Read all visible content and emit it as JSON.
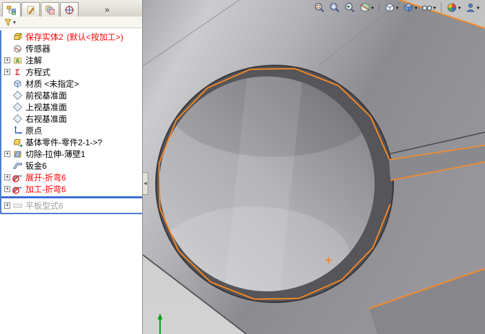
{
  "manager_panel": {
    "tabs": [
      {
        "name": "featuremanager-tree-tab",
        "icon": "design-tree",
        "active": true
      },
      {
        "name": "propertymanager-tab",
        "icon": "property",
        "active": false
      },
      {
        "name": "configurationmanager-tab",
        "icon": "configurations",
        "active": false
      },
      {
        "name": "dimxpert-tab",
        "icon": "dimxpert",
        "active": false
      }
    ],
    "overflow_glyph": "»",
    "filter": {
      "icon": "filter",
      "caret_glyph": "▾"
    },
    "collapse_glyph": "◀",
    "tree": {
      "expand_glyph": "+",
      "rollback_color": "#3a6bd8",
      "items": [
        {
          "label": "保存实体2",
          "suffix": "(默认<按加工>)",
          "icon": "part",
          "color": "#ff0000",
          "expandable": false
        },
        {
          "label": "传感器",
          "icon": "sensors",
          "expandable": false
        },
        {
          "label": "注解",
          "icon": "annotations",
          "expandable": true
        },
        {
          "label": "方程式",
          "icon": "equations",
          "expandable": true
        },
        {
          "label": "材质 <未指定>",
          "icon": "material",
          "expandable": false
        },
        {
          "label": "前视基准面",
          "icon": "plane",
          "expandable": false
        },
        {
          "label": "上视基准面",
          "icon": "plane",
          "expandable": false
        },
        {
          "label": "右视基准面",
          "icon": "plane",
          "expandable": false
        },
        {
          "label": "原点",
          "icon": "origin",
          "expandable": false
        },
        {
          "label": "基体零件-零件2-1->?",
          "icon": "base-part",
          "expandable": false
        },
        {
          "label": "切除-拉伸-薄壁1",
          "icon": "cut-extrude",
          "expandable": true
        },
        {
          "label": "钣金6",
          "icon": "sheet-metal",
          "expandable": false
        },
        {
          "label": "展开-折弯6",
          "icon": "bend-error",
          "expandable": true,
          "color": "#ff0000"
        },
        {
          "label": "加工-折弯6",
          "icon": "bend-error",
          "expandable": true,
          "color": "#ff0000"
        },
        {
          "label": "平板型式6",
          "icon": "flat-pattern",
          "expandable": true,
          "color": "#a0a0a0",
          "dimmed": true,
          "rollback_before": true
        }
      ]
    }
  },
  "view_toolbar": {
    "caret_glyph": "▾",
    "items": [
      {
        "type": "button",
        "name": "zoom-to-fit",
        "icon": "magnifier-fit",
        "caret": false
      },
      {
        "type": "button",
        "name": "zoom-to-area",
        "icon": "magnifier-area",
        "caret": false
      },
      {
        "type": "button",
        "name": "previous-view",
        "icon": "magnifier-prev",
        "caret": false
      },
      {
        "type": "button",
        "name": "section-view",
        "icon": "section",
        "caret": true
      },
      {
        "type": "separator"
      },
      {
        "type": "button",
        "name": "view-orientation",
        "icon": "view-cube",
        "caret": true
      },
      {
        "type": "button",
        "name": "display-style",
        "icon": "display-style",
        "caret": true
      },
      {
        "type": "button",
        "name": "hide-show-items",
        "icon": "eyeglasses",
        "caret": true
      },
      {
        "type": "separator"
      },
      {
        "type": "button",
        "name": "edit-appearance",
        "icon": "appearance-sphere",
        "caret": true
      },
      {
        "type": "button",
        "name": "apply-scene",
        "icon": "scene-person",
        "caret": true
      }
    ]
  },
  "viewport": {
    "background": "#c8c8c8",
    "model_edge_highlight": "#ff8a1e",
    "marker_glyph": "+"
  }
}
